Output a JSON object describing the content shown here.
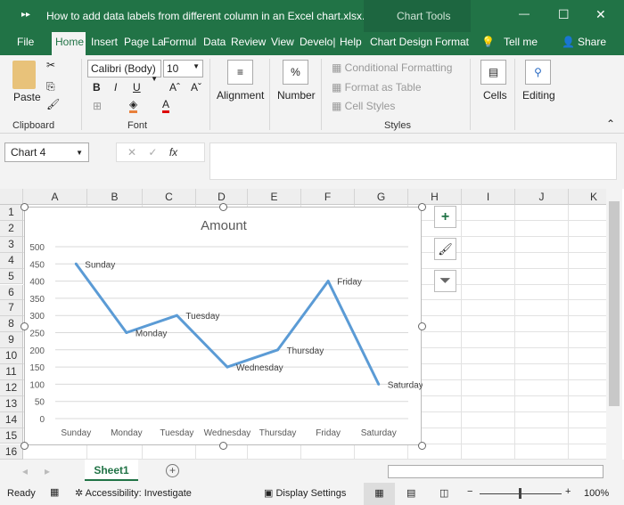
{
  "title_bar": {
    "title": "How to add data labels from different column in an Excel chart.xlsx...",
    "context": "Chart Tools",
    "minimize": "—",
    "maximize": "☐",
    "close": "✕",
    "qat": "▸▸"
  },
  "tabs": [
    "File",
    "Home",
    "Insert",
    "Page La",
    "Formul",
    "Data",
    "Review",
    "View",
    "Develo|",
    "Help",
    "Chart Design",
    "Format"
  ],
  "tell_me": "Tell me",
  "share": "Share",
  "ribbon": {
    "paste": "Paste",
    "clipboard": "Clipboard",
    "font_name": "Calibri (Body)",
    "font_size": "10",
    "bold": "B",
    "italic": "I",
    "underline": "U",
    "font": "Font",
    "alignment": "Alignment",
    "number": "Number",
    "percent": "%",
    "conditional": "Conditional Formatting",
    "format_table": "Format as Table",
    "cell_styles": "Cell Styles",
    "styles": "Styles",
    "cells": "Cells",
    "editing": "Editing"
  },
  "formula_bar": {
    "name_box": "Chart 4",
    "fx": "fx",
    "value": ""
  },
  "columns": [
    "A",
    "B",
    "C",
    "D",
    "E",
    "F",
    "G",
    "H",
    "I",
    "J",
    "K"
  ],
  "rows": [
    "1",
    "2",
    "3",
    "4",
    "5",
    "6",
    "7",
    "8",
    "9",
    "10",
    "11",
    "12",
    "13",
    "14",
    "15",
    "16"
  ],
  "chart_data": {
    "type": "line",
    "title": "Amount",
    "categories": [
      "Sunday",
      "Monday",
      "Tuesday",
      "Wednesday",
      "Thursday",
      "Friday",
      "Saturday"
    ],
    "values": [
      450,
      250,
      300,
      150,
      200,
      400,
      100
    ],
    "data_labels": [
      "Sunday",
      "Monday",
      "Tuesday",
      "Wednesday",
      "Thursday",
      "Friday",
      "Saturday"
    ],
    "ylim": [
      0,
      500
    ],
    "yticks": [
      "0",
      "50",
      "100",
      "150",
      "200",
      "250",
      "300",
      "350",
      "400",
      "450",
      "500"
    ],
    "color": "#5b9bd5",
    "grid": true
  },
  "chart_buttons": {
    "add": "+",
    "style": "🖌",
    "filter": "⏷"
  },
  "sheet_tabs": {
    "active": "Sheet1",
    "add": "+"
  },
  "status": {
    "ready": "Ready",
    "accessibility": "Accessibility: Investigate",
    "display": "Display Settings",
    "zoom": "100%"
  }
}
